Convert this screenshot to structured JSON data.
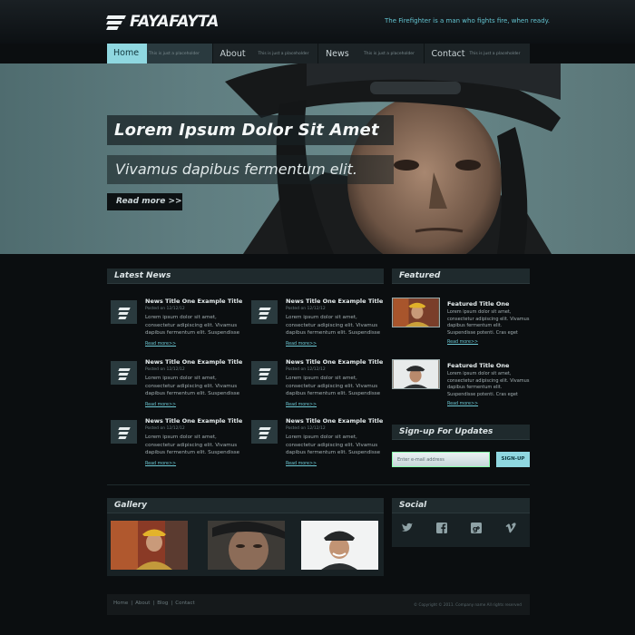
{
  "header": {
    "logo_text": "FAYAFAYTA",
    "tagline": "The Firefighter is a man who fights fire, when ready."
  },
  "nav": [
    {
      "label": "Home",
      "sub": "This is just a placeholder"
    },
    {
      "label": "About",
      "sub": "This is just a placeholder"
    },
    {
      "label": "News",
      "sub": "This is just a placeholder"
    },
    {
      "label": "Contact",
      "sub": "This is just a placeholder"
    }
  ],
  "hero": {
    "title": "Lorem Ipsum Dolor Sit Amet",
    "subtitle": "Vivamus dapibus fermentum elit.",
    "button": "Read more >>"
  },
  "latest_news": {
    "heading": "Latest News",
    "items": [
      {
        "title": "News Title One Example Title",
        "date": "Posted on 12/12/12",
        "body": "Lorem ipsum dolor sit amet, consectetur adipiscing elit. Vivamus dapibus fermentum elit. Suspendisse",
        "more": "Read more>>"
      },
      {
        "title": "News Title One Example Title",
        "date": "Posted on 12/12/12",
        "body": "Lorem ipsum dolor sit amet, consectetur adipiscing elit. Vivamus dapibus fermentum elit. Suspendisse",
        "more": "Read more>>"
      },
      {
        "title": "News Title One Example Title",
        "date": "Posted on 12/12/12",
        "body": "Lorem ipsum dolor sit amet, consectetur adipiscing elit. Vivamus dapibus fermentum elit. Suspendisse",
        "more": "Read more>>"
      },
      {
        "title": "News Title One Example Title",
        "date": "Posted on 12/12/12",
        "body": "Lorem ipsum dolor sit amet, consectetur adipiscing elit. Vivamus dapibus fermentum elit. Suspendisse",
        "more": "Read more>>"
      },
      {
        "title": "News Title One Example Title",
        "date": "Posted on 12/12/12",
        "body": "Lorem ipsum dolor sit amet, consectetur adipiscing elit. Vivamus dapibus fermentum elit. Suspendisse",
        "more": "Read more>>"
      },
      {
        "title": "News Title One Example Title",
        "date": "Posted on 12/12/12",
        "body": "Lorem ipsum dolor sit amet, consectetur adipiscing elit. Vivamus dapibus fermentum elit. Suspendisse",
        "more": "Read more>>"
      }
    ]
  },
  "featured": {
    "heading": "Featured",
    "items": [
      {
        "title": "Featured Title One",
        "body": "Lorem ipsum dolor sit amet, consectetur adipiscing elit. Vivamus dapibus fermentum elit. Suspendisse potenti. Cras eget",
        "more": "Read more>>"
      },
      {
        "title": "Featured Title One",
        "body": "Lorem ipsum dolor sit amet, consectetur adipiscing elit. Vivamus dapibus fermentum elit. Suspendisse potenti. Cras eget",
        "more": "Read more>>"
      }
    ]
  },
  "signup": {
    "heading": "Sign-up For Updates",
    "placeholder": "Enter e-mail address",
    "button": "SIGN-UP"
  },
  "gallery": {
    "heading": "Gallery"
  },
  "social": {
    "heading": "Social",
    "icons": [
      "twitter-icon",
      "facebook-icon",
      "google-plus-icon",
      "vimeo-icon"
    ]
  },
  "footer": {
    "links": [
      "Home",
      "About",
      "Blog",
      "Contact"
    ],
    "separator": "|",
    "copyright": "© Copyright © 2011. Company name All rights reserved"
  },
  "colors": {
    "accent": "#8fd7e0",
    "background": "#0b0e10",
    "hero": "#5f7d80"
  }
}
